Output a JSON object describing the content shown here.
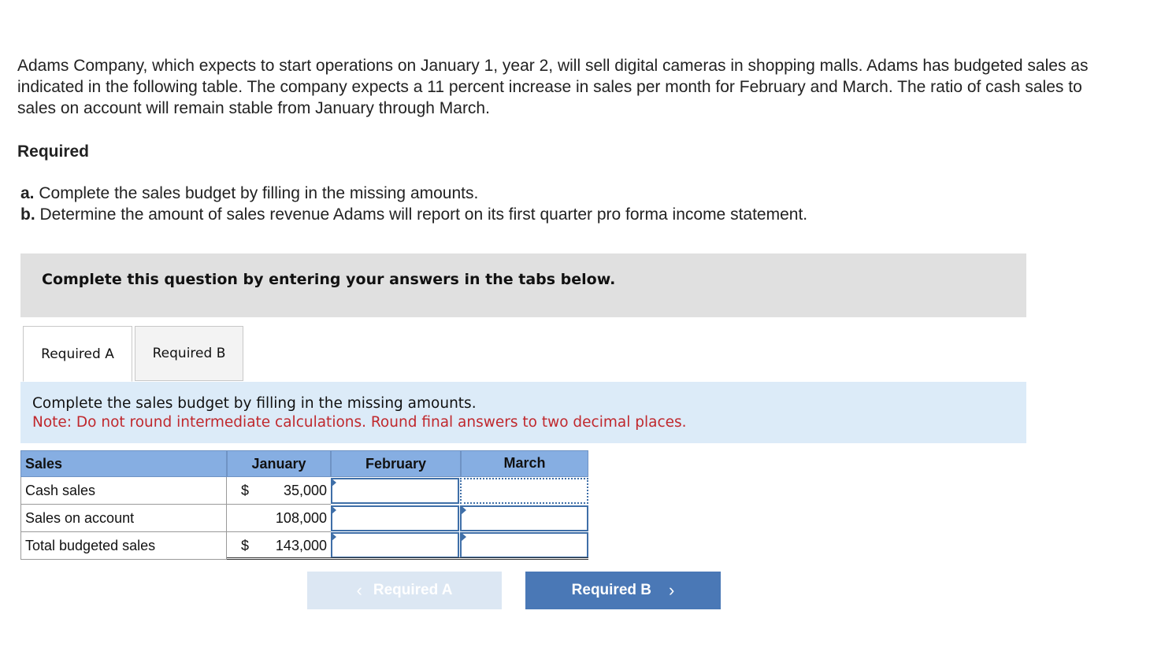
{
  "problem": {
    "intro": "Adams Company, which expects to start operations on January 1, year 2, will sell digital cameras in shopping malls. Adams has budgeted sales as indicated in the following table. The company expects a 11 percent increase in sales per month for February and March. The ratio of cash sales to sales on account will remain stable from January through March.",
    "required_heading": "Required",
    "items": [
      {
        "letter": "a.",
        "text": "Complete the sales budget by filling in the missing amounts."
      },
      {
        "letter": "b.",
        "text": "Determine the amount of sales revenue Adams will report on its first quarter pro forma income statement."
      }
    ]
  },
  "banner": {
    "text": "Complete this question by entering your answers in the tabs below."
  },
  "tabs": [
    {
      "label": "Required A",
      "active": true
    },
    {
      "label": "Required B",
      "active": false
    }
  ],
  "instructions": {
    "main": "Complete the sales budget by filling in the missing amounts.",
    "note": "Note: Do not round intermediate calculations. Round final answers to two decimal places."
  },
  "budget": {
    "headers": [
      "Sales",
      "January",
      "February",
      "March"
    ],
    "rows": [
      {
        "label": "Cash sales",
        "jan_dollar": "$",
        "jan_value": "35,000",
        "feb_value": "",
        "mar_value": ""
      },
      {
        "label": "Sales on account",
        "jan_dollar": "",
        "jan_value": "108,000",
        "feb_value": "",
        "mar_value": ""
      },
      {
        "label": "Total budgeted sales",
        "jan_dollar": "$",
        "jan_value": "143,000",
        "feb_value": "",
        "mar_value": ""
      }
    ]
  },
  "nav": {
    "prev_label": "Required A",
    "next_label": "Required B",
    "prev_icon": "chevron-left-icon",
    "next_icon": "chevron-right-icon"
  },
  "colors": {
    "header_blue": "#86aee2",
    "instruction_bg": "#dcebf8",
    "note_red": "#c0282d",
    "button_blue": "#4a78b6",
    "button_disabled": "#dce7f3"
  }
}
